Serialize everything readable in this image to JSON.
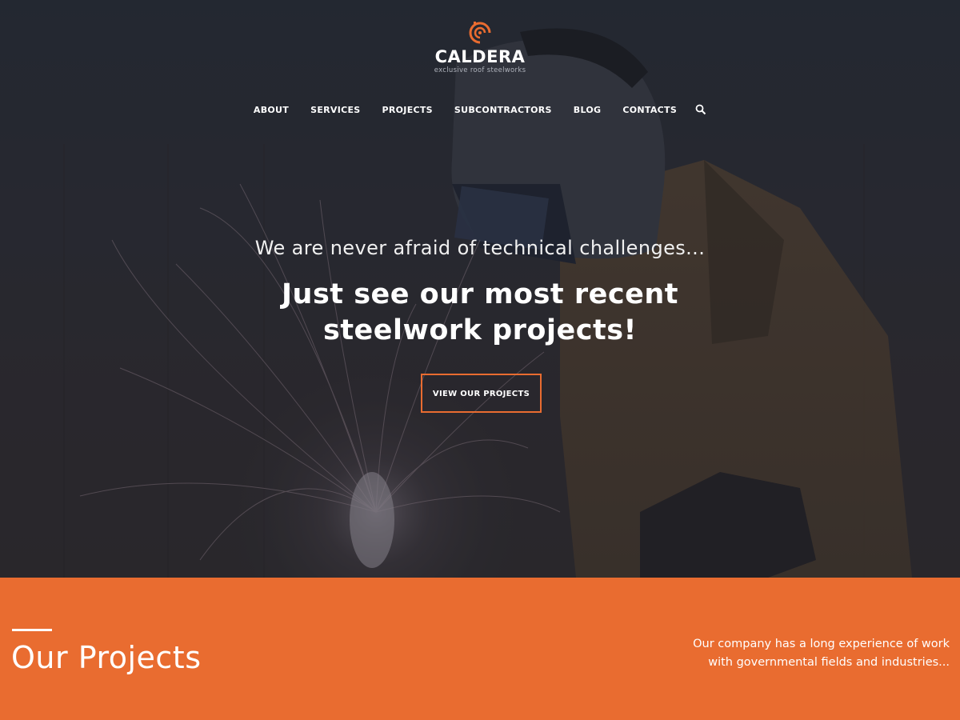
{
  "brand": {
    "name": "CALDERA",
    "tagline": "exclusive roof steelworks",
    "accent_color": "#e96c30"
  },
  "nav": {
    "items": [
      {
        "label": "ABOUT"
      },
      {
        "label": "SERVICES"
      },
      {
        "label": "PROJECTS"
      },
      {
        "label": "SUBCONTRACTORS"
      },
      {
        "label": "BLOG"
      },
      {
        "label": "CONTACTS"
      }
    ],
    "search_icon": "search-icon"
  },
  "hero": {
    "subtitle": "We are never afraid of technical challenges...",
    "title_line1": "Just see our most recent",
    "title_line2": "steelwork projects!",
    "cta_label": "VIEW OUR PROJECTS",
    "background": "welder with sparks, dark overlay"
  },
  "projects_section": {
    "title": "Our Projects",
    "description_line1": "Our company has a long experience of work",
    "description_line2": "with governmental fields and industries...",
    "background_color": "#e96c30"
  }
}
